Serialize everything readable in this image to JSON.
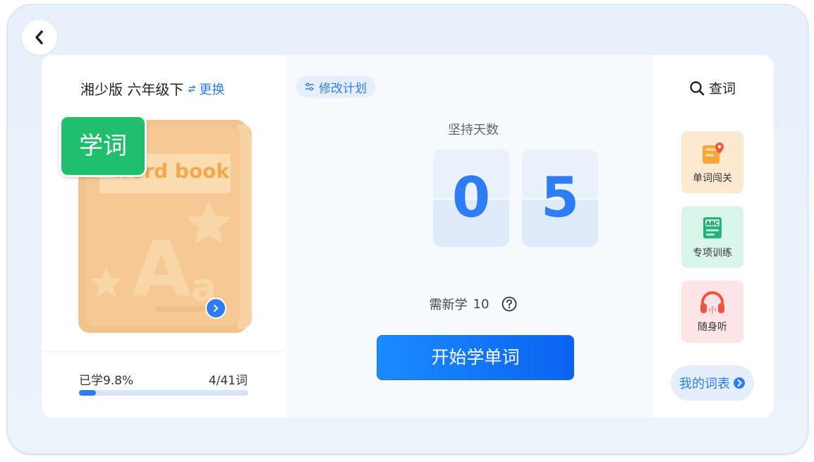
{
  "nav": {
    "back_icon": "chevron-left-icon"
  },
  "book": {
    "title": "湘少版 六年级下",
    "change_label": "更换",
    "cover_text": "word book",
    "cover_letters_big": "A",
    "cover_letters_small": "a",
    "badge_label": "学词"
  },
  "progress": {
    "learned_label": "已学9.8%",
    "count_label": "4/41词",
    "fraction": 0.098
  },
  "plan": {
    "modify_label": "修改计划",
    "days_label": "坚持天数",
    "digits": [
      "0",
      "5"
    ],
    "need_label": "需新学",
    "need_value": "10",
    "start_label": "开始学单词"
  },
  "tools": {
    "search_label": "查词",
    "features": [
      {
        "label": "单词闯关",
        "icon": "map-icon"
      },
      {
        "label": "专项训练",
        "icon": "abc-book-icon"
      },
      {
        "label": "随身听",
        "icon": "headphones-icon"
      }
    ],
    "wordlist_label": "我的词表"
  },
  "colors": {
    "accent": "#2f7df6",
    "badge": "#1fbf6d",
    "book": "#f0c48f"
  }
}
